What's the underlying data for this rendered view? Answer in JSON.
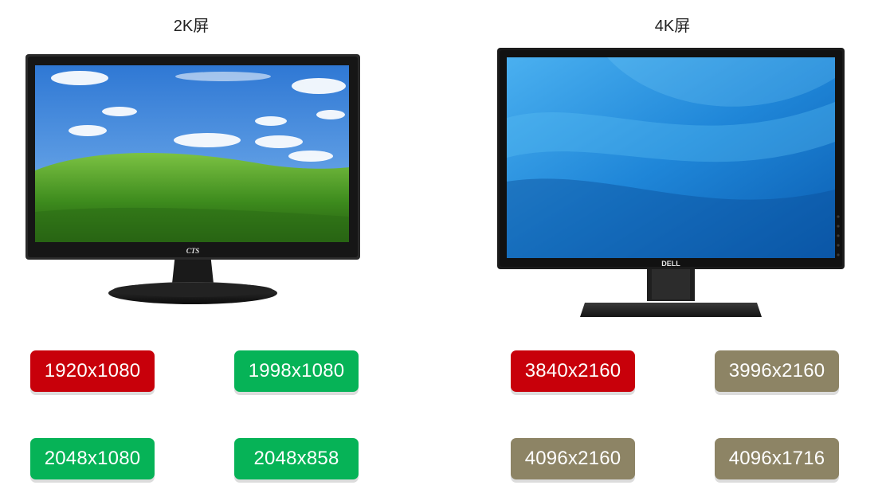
{
  "panels": {
    "left": {
      "title": "2K屏",
      "logo": "CTS"
    },
    "right": {
      "title": "4K屏",
      "logo": "DELL"
    }
  },
  "resolutions": {
    "left": [
      {
        "label": "1920x1080",
        "color": "#c8000a"
      },
      {
        "label": "1998x1080",
        "color": "#06b357"
      },
      {
        "label": "2048x1080",
        "color": "#06b357"
      },
      {
        "label": "2048x858",
        "color": "#06b357"
      }
    ],
    "right": [
      {
        "label": "3840x2160",
        "color": "#c8000a"
      },
      {
        "label": "3996x2160",
        "color": "#8d8465"
      },
      {
        "label": "4096x2160",
        "color": "#8d8465"
      },
      {
        "label": "4096x1716",
        "color": "#8d8465"
      }
    ]
  }
}
